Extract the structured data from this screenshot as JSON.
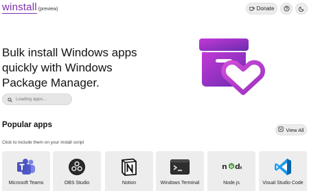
{
  "header": {
    "logo": "winstall",
    "badge": "(preview)",
    "donate_label": "Donate"
  },
  "hero": {
    "title": "Bulk install Windows apps quickly with Windows Package Manager."
  },
  "search": {
    "placeholder": "Loading apps..."
  },
  "popular": {
    "title": "Popular apps",
    "subtitle": "Click to include them on your install script",
    "view_all_label": "View All",
    "apps": [
      {
        "name": "Microsoft Teams",
        "icon": "teams-icon"
      },
      {
        "name": "OBS Studio",
        "icon": "obs-icon"
      },
      {
        "name": "Notion",
        "icon": "notion-icon"
      },
      {
        "name": "Windows Terminal",
        "icon": "terminal-icon"
      },
      {
        "name": "Node.js",
        "icon": "nodejs-icon"
      },
      {
        "name": "Visual Studio Code",
        "icon": "vscode-icon"
      }
    ]
  },
  "colors": {
    "brand": "#7b2ea8",
    "box_gradient_start": "#c33ad6",
    "box_gradient_end": "#6a2bb0",
    "card_bg": "#ededed"
  }
}
